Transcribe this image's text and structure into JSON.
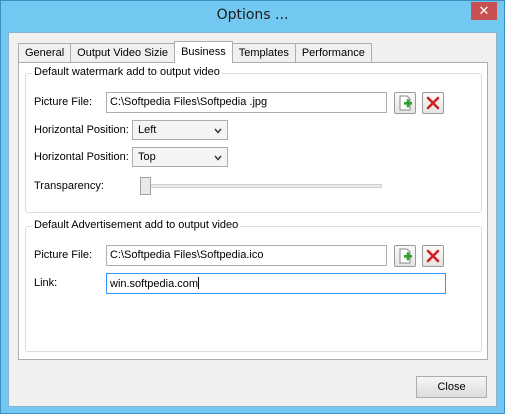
{
  "window": {
    "title": "Options ...",
    "close_glyph": "✕"
  },
  "tabs": [
    {
      "label": "General"
    },
    {
      "label": "Output Video Sizie"
    },
    {
      "label": "Business"
    },
    {
      "label": "Templates"
    },
    {
      "label": "Performance"
    }
  ],
  "active_tab": "Business",
  "watermark": {
    "title": "Default watermark add to output video",
    "picture_label": "Picture File:",
    "picture_value": "C:\\Softpedia Files\\Softpedia .jpg",
    "hpos_label": "Horizontal Position:",
    "hpos_value": "Left",
    "vpos_label": "Horizontal Position:",
    "vpos_value": "Top",
    "transparency_label": "Transparency:",
    "transparency_level": 0
  },
  "advertisement": {
    "title": "Default Advertisement add to output video",
    "picture_label": "Picture File:",
    "picture_value": "C:\\Softpedia Files\\Softpedia.ico",
    "link_label": "Link:",
    "link_value": "win.softpedia.com"
  },
  "footer": {
    "close_label": "Close"
  },
  "icons": {
    "add": "add-file-icon",
    "delete": "delete-icon"
  },
  "colors": {
    "add_green": "#2ea02e",
    "delete_red": "#d42020",
    "titlebar": "#72c8f0"
  }
}
